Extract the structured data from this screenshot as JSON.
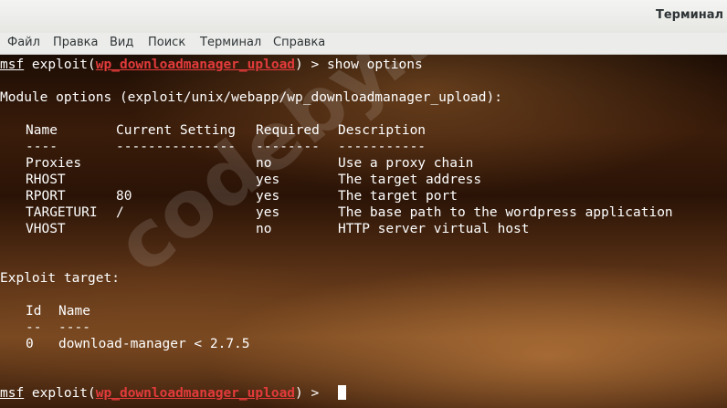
{
  "window": {
    "title": "Терминал"
  },
  "menu": [
    "Файл",
    "Правка",
    "Вид",
    "Поиск",
    "Терминал",
    "Справка"
  ],
  "terminal": {
    "prompt1": {
      "msf": "msf",
      "pre": " exploit(",
      "module": "wp_downloadmanager_upload",
      "post": ") > ",
      "command": "show options"
    },
    "module_header": "Module options (exploit/unix/webapp/wp_downloadmanager_upload):",
    "options_headers": {
      "name": "Name",
      "setting": "Current Setting",
      "required": "Required",
      "description": "Description"
    },
    "options_dashes": {
      "name": "----",
      "setting": "---------------",
      "required": "--------",
      "description": "-----------"
    },
    "options": [
      {
        "name": "Proxies",
        "setting": "",
        "required": "no",
        "description": "Use a proxy chain"
      },
      {
        "name": "RHOST",
        "setting": "",
        "required": "yes",
        "description": "The target address"
      },
      {
        "name": "RPORT",
        "setting": "80",
        "required": "yes",
        "description": "The target port"
      },
      {
        "name": "TARGETURI",
        "setting": "/",
        "required": "yes",
        "description": "The base path to the wordpress application"
      },
      {
        "name": "VHOST",
        "setting": "",
        "required": "no",
        "description": "HTTP server virtual host"
      }
    ],
    "exploit_target_header": "Exploit target:",
    "target_headers": {
      "id": "Id",
      "name": "Name"
    },
    "target_dashes": {
      "id": "--",
      "name": "----"
    },
    "targets": [
      {
        "id": "0",
        "name": "download-manager < 2.7.5"
      }
    ],
    "prompt2": {
      "msf": "msf",
      "pre": " exploit(",
      "module": "wp_downloadmanager_upload",
      "post": ") > "
    }
  },
  "watermark": "codeby.net"
}
